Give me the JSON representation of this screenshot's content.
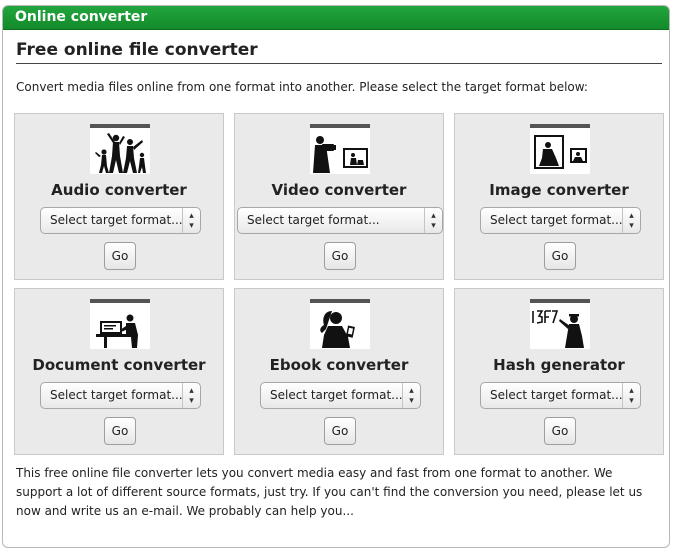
{
  "panel": {
    "header": "Online converter",
    "title": "Free online file converter",
    "intro": "Convert media files online from one format into another. Please select the target format below:"
  },
  "tiles": [
    {
      "label": "Audio converter",
      "select": "Select target format...",
      "go": "Go",
      "icon": "dancers-icon"
    },
    {
      "label": "Video converter",
      "select": "Select target format...",
      "go": "Go",
      "icon": "video-camera-icon"
    },
    {
      "label": "Image converter",
      "select": "Select target format...",
      "go": "Go",
      "icon": "photo-icon"
    },
    {
      "label": "Document converter",
      "select": "Select target format...",
      "go": "Go",
      "icon": "document-typing-icon"
    },
    {
      "label": "Ebook converter",
      "select": "Select target format...",
      "go": "Go",
      "icon": "ebook-reader-icon"
    },
    {
      "label": "Hash generator",
      "select": "Select target format...",
      "go": "Go",
      "icon": "hash-graffiti-icon"
    }
  ],
  "footer": {
    "text": "This free online file converter lets you convert media easy and fast from one format to another. We support a lot of different source formats, just try. If you can't find the conversion you need, please let us now and write us an e-mail. We probably can help you..."
  },
  "colors": {
    "header_green": "#1a9a35",
    "tile_bg": "#eaeaea"
  }
}
